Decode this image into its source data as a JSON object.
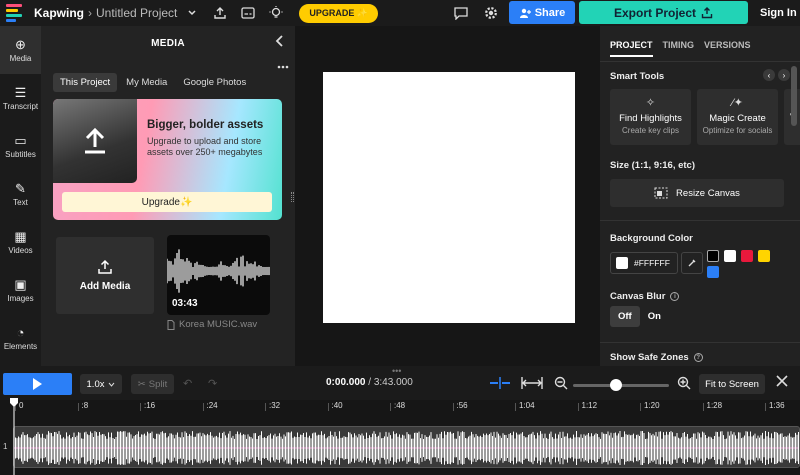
{
  "topbar": {
    "brand": "Kapwing",
    "separator": "›",
    "project_name": "Untitled Project",
    "upgrade_label": "UPGRADE ✨",
    "share_label": "Share",
    "export_label": "Export Project",
    "signin_label": "Sign In"
  },
  "leftnav": {
    "items": [
      {
        "label": "Media",
        "icon": "media-icon",
        "glyph": "⊕"
      },
      {
        "label": "Transcript",
        "icon": "transcript-icon",
        "glyph": "☰"
      },
      {
        "label": "Subtitles",
        "icon": "subtitles-icon",
        "glyph": "▭"
      },
      {
        "label": "Text",
        "icon": "text-icon",
        "glyph": "✎"
      },
      {
        "label": "Videos",
        "icon": "videos-icon",
        "glyph": "▦"
      },
      {
        "label": "Images",
        "icon": "images-icon",
        "glyph": "▣"
      },
      {
        "label": "Elements",
        "icon": "elements-icon",
        "glyph": "◔"
      }
    ]
  },
  "media": {
    "title": "MEDIA",
    "tabs": [
      "This Project",
      "My Media",
      "Google Photos"
    ],
    "promo": {
      "title": "Bigger, bolder assets",
      "text": "Upgrade to upload and store assets over 250+ megabytes",
      "button": "Upgrade✨"
    },
    "add_media_label": "Add Media",
    "audio": {
      "duration": "03:43",
      "filename": "Korea MUSIC.wav"
    }
  },
  "right": {
    "tabs": [
      "PROJECT",
      "TIMING",
      "VERSIONS"
    ],
    "smart_tools_label": "Smart Tools",
    "tools": [
      {
        "title": "Find Highlights",
        "subtitle": "Create key clips",
        "icon": "sparkle-icon"
      },
      {
        "title": "Magic Create",
        "subtitle": "Optimize for socials",
        "icon": "magic-wand-icon"
      },
      {
        "title": "V",
        "subtitle": "",
        "icon": ""
      }
    ],
    "size_label": "Size (1:1, 9:16, etc)",
    "resize_label": "Resize Canvas",
    "bg_color_label": "Background Color",
    "hex_value": "#FFFFFF",
    "swatches": [
      "#000000",
      "#ffffff",
      "#e8193c",
      "#ffd400",
      "#2b7ff7"
    ],
    "canvas_blur_label": "Canvas Blur",
    "blur_options": [
      "Off",
      "On"
    ],
    "safe_zones_label": "Show Safe Zones"
  },
  "timeline": {
    "speed": "1.0x",
    "split_label": "Split",
    "current_time": "0:00.000",
    "total_time": "3:43.000",
    "fit_label": "Fit to Screen",
    "zoom_level": 0.45,
    "track_number": "1",
    "ruler_labels": [
      "0",
      ":8",
      ":16",
      ":24",
      ":32",
      ":40",
      ":48",
      ":56",
      "1:04",
      "1:12",
      "1:20",
      "1:28",
      "1:36"
    ]
  },
  "colors": {
    "accent_blue": "#2b7ff7",
    "export_teal": "#22d3b6",
    "upgrade_yellow": "#ffcc00"
  }
}
